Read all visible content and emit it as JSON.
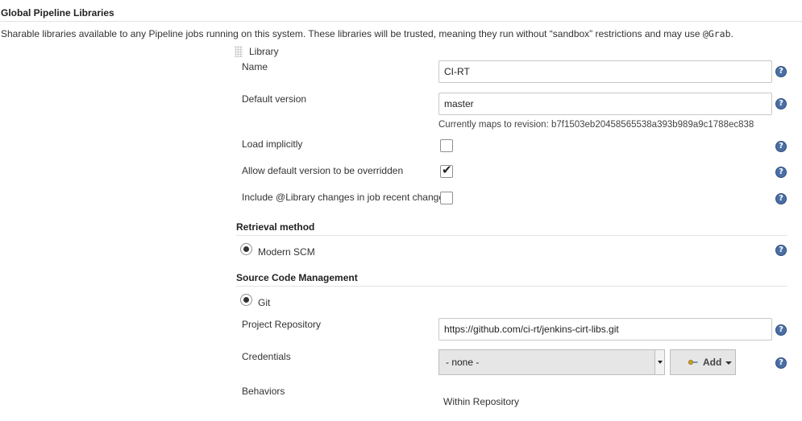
{
  "section": {
    "title": "Global Pipeline Libraries",
    "description": "Sharable libraries available to any Pipeline jobs running on this system. These libraries will be trusted, meaning they run without “sandbox” restrictions and may use",
    "description_code": "@Grab",
    "description_end": "."
  },
  "library": {
    "header": "Library",
    "name_label": "Name",
    "name_value": "CI-RT",
    "default_version_label": "Default version",
    "default_version_value": "master",
    "revision_hint": "Currently maps to revision: b7f1503eb20458565538a393b989a9c1788ec838",
    "load_implicitly_label": "Load implicitly",
    "load_implicitly_checked": false,
    "allow_override_label": "Allow default version to be overridden",
    "allow_override_checked": true,
    "include_changes_label": "Include @Library changes in job recent changes",
    "include_changes_checked": false
  },
  "retrieval": {
    "title": "Retrieval method",
    "option": "Modern SCM"
  },
  "scm": {
    "title": "Source Code Management",
    "option": "Git",
    "project_repo_label": "Project Repository",
    "project_repo_value": "https://github.com/ci-rt/jenkins-cirt-libs.git",
    "credentials_label": "Credentials",
    "credentials_value": "- none -",
    "add_label": "Add",
    "behaviors_label": "Behaviors",
    "behaviors_item": "Within Repository"
  },
  "help_icon": "help-icon",
  "colors": {
    "help_icon_bg": "#4a6fa5",
    "rule": "#e2e2e2"
  }
}
